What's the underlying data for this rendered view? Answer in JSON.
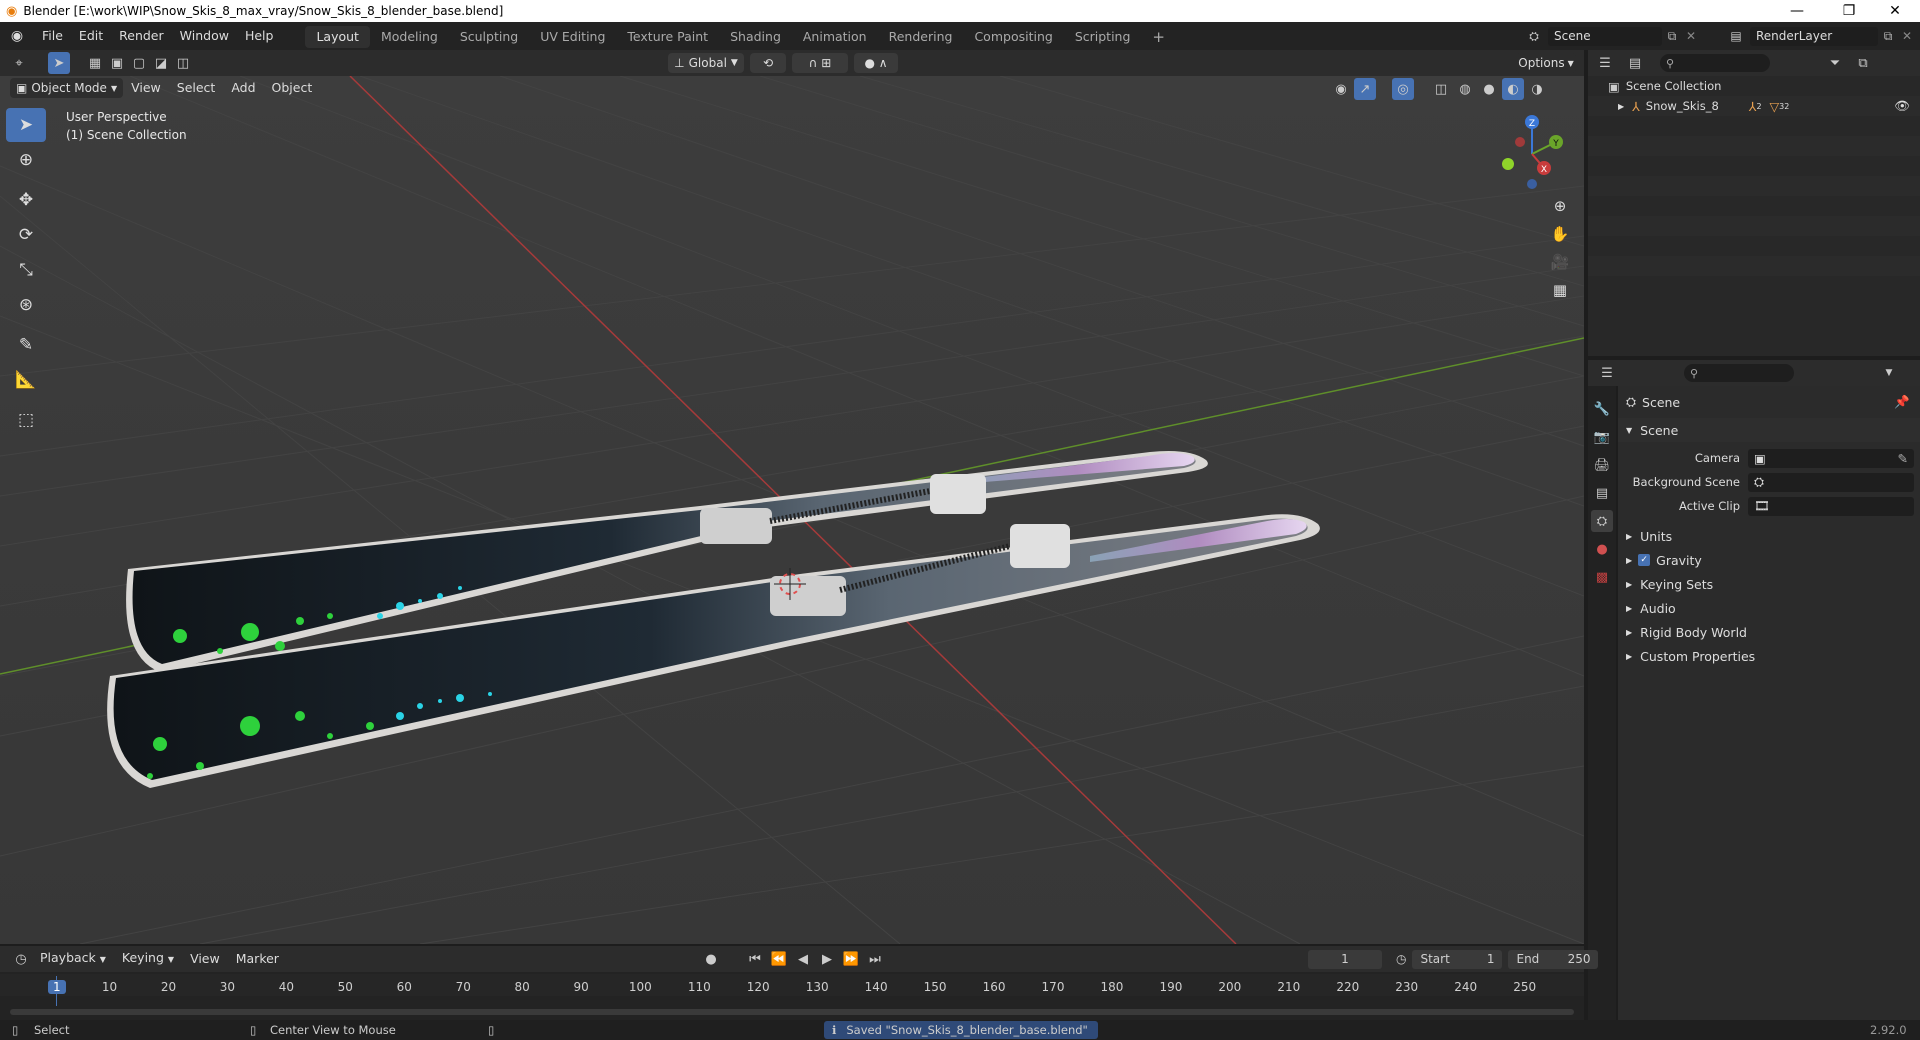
{
  "window": {
    "title": "Blender [E:\\work\\WIP\\Snow_Skis_8_max_vray/Snow_Skis_8_blender_base.blend]",
    "controls": [
      "—",
      "❐",
      "✕"
    ]
  },
  "menus": [
    "File",
    "Edit",
    "Render",
    "Window",
    "Help"
  ],
  "workspaces": [
    "Layout",
    "Modeling",
    "Sculpting",
    "UV Editing",
    "Texture Paint",
    "Shading",
    "Animation",
    "Rendering",
    "Compositing",
    "Scripting"
  ],
  "active_workspace": "Layout",
  "add_workspace": "+",
  "scene_field": "Scene",
  "renderlayer_field": "RenderLayer",
  "viewport_header": {
    "transform_orientation": "Global",
    "options": "Options",
    "mode": "Object Mode",
    "menus": [
      "View",
      "Select",
      "Add",
      "Object"
    ]
  },
  "viewport_overlay": {
    "line1": "User Perspective",
    "line2": "(1) Scene Collection"
  },
  "gizmo": {
    "z": "Z",
    "y": "Y",
    "x": "X"
  },
  "outliner": {
    "root": "Scene Collection",
    "items": [
      {
        "label": "Snow_Skis_8",
        "badge1": "2",
        "badge2": "32"
      }
    ]
  },
  "properties": {
    "breadcrumb": "Scene",
    "panel": "Scene",
    "fields": [
      {
        "label": "Camera",
        "value": ""
      },
      {
        "label": "Background Scene",
        "value": ""
      },
      {
        "label": "Active Clip",
        "value": ""
      }
    ],
    "subpanels": [
      "Units",
      "Gravity",
      "Keying Sets",
      "Audio",
      "Rigid Body World",
      "Custom Properties"
    ],
    "gravity_checked": true
  },
  "timeline": {
    "menus": [
      "Playback",
      "Keying",
      "View",
      "Marker"
    ],
    "current_frame": "1",
    "start_label": "Start",
    "start": "1",
    "end_label": "End",
    "end": "250",
    "ticks": [
      "1",
      "10",
      "20",
      "30",
      "40",
      "50",
      "60",
      "70",
      "80",
      "90",
      "100",
      "110",
      "120",
      "130",
      "140",
      "150",
      "160",
      "170",
      "180",
      "190",
      "200",
      "210",
      "220",
      "230",
      "240",
      "250"
    ]
  },
  "statusbar": {
    "left": "Select",
    "middle": "Center View to Mouse",
    "message": "Saved \"Snow_Skis_8_blender_base.blend\"",
    "version": "2.92.0"
  },
  "colors": {
    "accent": "#4772b3",
    "x_axis": "#c83c3c",
    "y_axis": "#6aa52a",
    "z_axis": "#3b78d8"
  }
}
